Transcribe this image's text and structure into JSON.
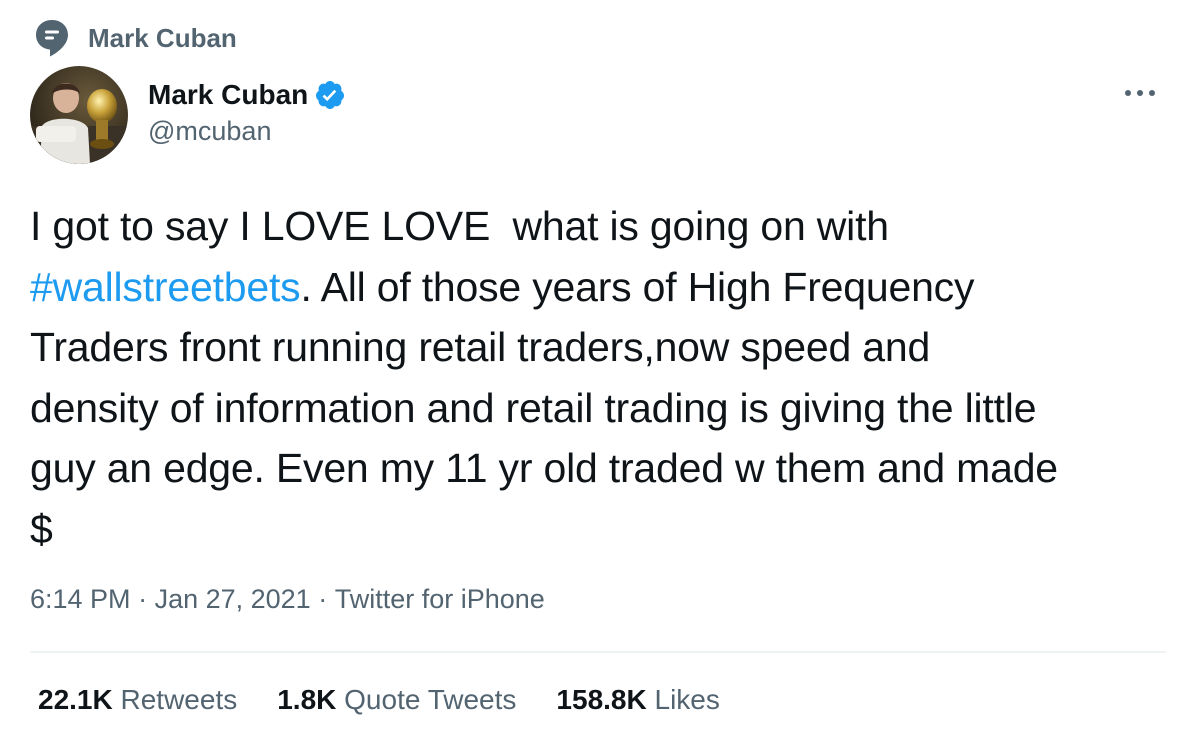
{
  "context": {
    "label": "Mark Cuban",
    "icon": "speech-bubble-icon"
  },
  "author": {
    "display_name": "Mark Cuban",
    "handle": "@mcuban",
    "verified": true,
    "avatar": "avatar"
  },
  "tweet": {
    "text_before": "I got to say I LOVE LOVE  what is going on with\n",
    "hashtag": "#wallstreetbets",
    "text_after": ". All of those years of High Frequency\nTraders front running retail traders,now speed and\ndensity of information and retail trading is giving the little\nguy an edge. Even my 11 yr old traded w them and made\n$"
  },
  "meta": {
    "time": "6:14 PM",
    "separator": " · ",
    "date": "Jan 27, 2021",
    "source": "Twitter for iPhone"
  },
  "stats": [
    {
      "count": "22.1K",
      "label": "Retweets"
    },
    {
      "count": "1.8K",
      "label": "Quote Tweets"
    },
    {
      "count": "158.8K",
      "label": "Likes"
    }
  ],
  "colors": {
    "accent": "#1d9bf0",
    "secondary_text": "#536471",
    "primary_text": "#0f1419",
    "divider": "#eff3f4"
  }
}
